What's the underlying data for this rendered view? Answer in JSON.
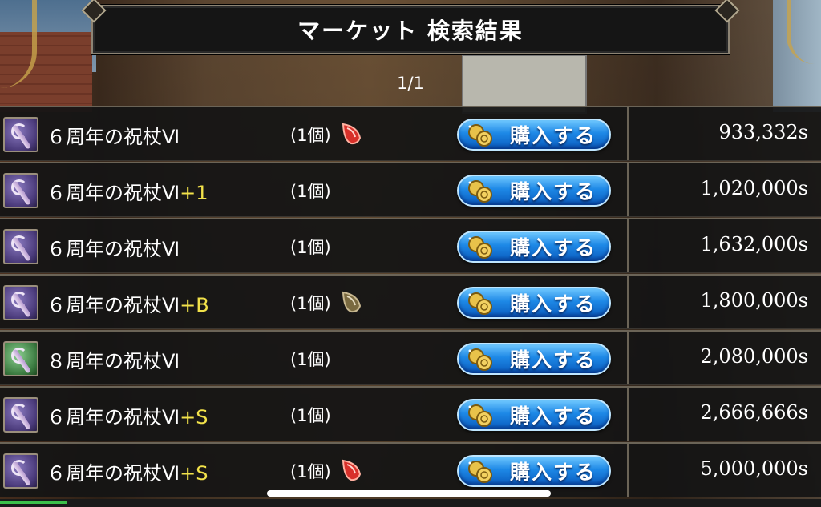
{
  "header": {
    "title": "マーケット 検索結果",
    "page_indicator": "1/1"
  },
  "buy_label": "購入する",
  "listings": [
    {
      "name": "６周年の祝杖Ⅵ",
      "suffix": "",
      "quantity": "(1個)",
      "gem": "red-gem-icon",
      "price": "933,332s",
      "icon": "purple-staff-icon"
    },
    {
      "name": "６周年の祝杖Ⅵ",
      "suffix": "+1",
      "quantity": "(1個)",
      "gem": "",
      "price": "1,020,000s",
      "icon": "purple-staff-icon"
    },
    {
      "name": "６周年の祝杖Ⅵ",
      "suffix": "",
      "quantity": "(1個)",
      "gem": "",
      "price": "1,632,000s",
      "icon": "purple-staff-icon"
    },
    {
      "name": "６周年の祝杖Ⅵ",
      "suffix": "+B",
      "quantity": "(1個)",
      "gem": "brown-gem-icon",
      "price": "1,800,000s",
      "icon": "purple-staff-icon"
    },
    {
      "name": "８周年の祝杖Ⅵ",
      "suffix": "",
      "quantity": "(1個)",
      "gem": "",
      "price": "2,080,000s",
      "icon": "green-staff-icon"
    },
    {
      "name": "６周年の祝杖Ⅵ",
      "suffix": "+S",
      "quantity": "(1個)",
      "gem": "",
      "price": "2,666,666s",
      "icon": "purple-staff-icon"
    },
    {
      "name": "６周年の祝杖Ⅵ",
      "suffix": "+S",
      "quantity": "(1個)",
      "gem": "red-gem-icon",
      "price": "5,000,000s",
      "icon": "purple-staff-icon"
    }
  ],
  "colors": {
    "suffix": "#f2e24a",
    "button": "#1d88e6",
    "red_gem": "#d8302a",
    "brown_gem": "#7a6a40"
  }
}
